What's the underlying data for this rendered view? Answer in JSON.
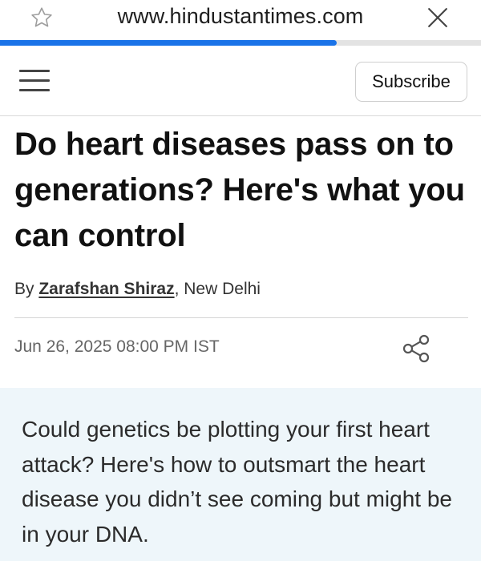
{
  "browser": {
    "url": "www.hindustantimes.com",
    "bookmark_icon": "star-outline-icon",
    "close_icon": "close-icon",
    "load_progress": 0.7
  },
  "header": {
    "menu_icon": "hamburger-menu-icon",
    "subscribe_label": "Subscribe"
  },
  "article": {
    "headline": "Do heart diseases pass on to generations? Here's what you can control",
    "byline_prefix": "By",
    "author": "Zarafshan Shiraz",
    "location": ", New Delhi",
    "date": "Jun 26, 2025 08:00 PM IST",
    "share_icon": "share-icon",
    "summary": "Could genetics be plotting your first heart attack? Here's how to outsmart the heart disease you didn’t see coming but might be in your DNA."
  },
  "colors": {
    "progress": "#1a73e8",
    "summary_bg": "#eef6fa"
  }
}
